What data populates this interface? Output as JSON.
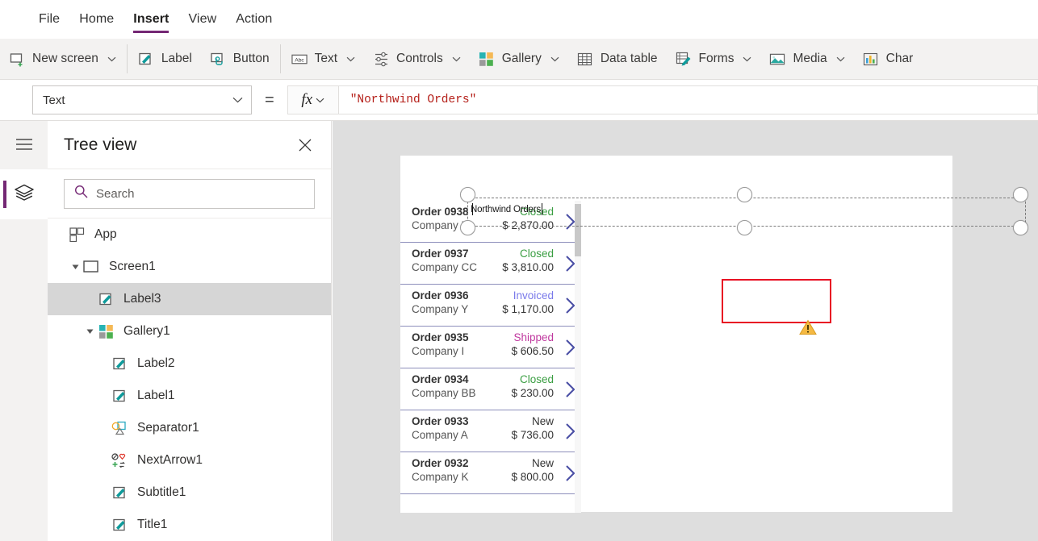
{
  "menu": {
    "items": [
      {
        "label": "File",
        "active": false
      },
      {
        "label": "Home",
        "active": false
      },
      {
        "label": "Insert",
        "active": true
      },
      {
        "label": "View",
        "active": false
      },
      {
        "label": "Action",
        "active": false
      }
    ],
    "accent_color": "#742774"
  },
  "ribbon": {
    "groups": [
      {
        "items": [
          {
            "label": "New screen",
            "icon": "new-screen-icon",
            "caret": true
          }
        ]
      },
      {
        "items": [
          {
            "label": "Label",
            "icon": "label-icon",
            "caret": false
          },
          {
            "label": "Button",
            "icon": "button-icon",
            "caret": false
          }
        ]
      },
      {
        "items": [
          {
            "label": "Text",
            "icon": "text-abc-icon",
            "caret": true
          },
          {
            "label": "Controls",
            "icon": "controls-sliders-icon",
            "caret": true
          },
          {
            "label": "Gallery",
            "icon": "gallery-grid-icon",
            "caret": true
          },
          {
            "label": "Data table",
            "icon": "data-table-icon",
            "caret": false
          },
          {
            "label": "Forms",
            "icon": "forms-icon",
            "caret": true
          },
          {
            "label": "Media",
            "icon": "media-image-icon",
            "caret": true
          },
          {
            "label": "Char",
            "icon": "chart-bars-icon",
            "caret": false
          }
        ]
      }
    ]
  },
  "formula_bar": {
    "property": "Text",
    "equals": "=",
    "fx_label": "fx",
    "formula": "\"Northwind Orders\"",
    "formula_color": "#b5201a"
  },
  "left_rail": {
    "hamburger": "hamburger-menu-icon",
    "buttons": [
      {
        "name": "tree-view-layers",
        "icon": "layers-icon",
        "active": true
      }
    ]
  },
  "tree_view": {
    "title": "Tree view",
    "close_label": "✕",
    "search_placeholder": "Search",
    "nodes": [
      {
        "label": "App",
        "icon": "app-icon",
        "indent": 0,
        "twisty": "",
        "selected": false
      },
      {
        "label": "Screen1",
        "icon": "screen-icon",
        "indent": 1,
        "twisty": "expanded",
        "selected": false
      },
      {
        "label": "Label3",
        "icon": "label-pencil-icon",
        "indent": 2,
        "twisty": "",
        "selected": true
      },
      {
        "label": "Gallery1",
        "icon": "gallery-grid-icon",
        "indent": 1,
        "twisty": "expanded",
        "selected": false
      },
      {
        "label": "Label2",
        "icon": "label-pencil-icon",
        "indent": 3,
        "twisty": "",
        "selected": false
      },
      {
        "label": "Label1",
        "icon": "label-pencil-icon",
        "indent": 3,
        "twisty": "",
        "selected": false
      },
      {
        "label": "Separator1",
        "icon": "separator-shapes-icon",
        "indent": 3,
        "twisty": "",
        "selected": false
      },
      {
        "label": "NextArrow1",
        "icon": "icon-set-icon",
        "indent": 3,
        "twisty": "",
        "selected": false
      },
      {
        "label": "Subtitle1",
        "icon": "label-pencil-icon",
        "indent": 3,
        "twisty": "",
        "selected": false
      },
      {
        "label": "Title1",
        "icon": "label-pencil-icon",
        "indent": 3,
        "twisty": "",
        "selected": false
      }
    ]
  },
  "canvas": {
    "selected_label": {
      "text": "Northwind Orders",
      "editing": true,
      "highlight_color": "#e81123",
      "warning_icon": "warning-triangle-icon"
    },
    "gallery": {
      "status_colors": {
        "Closed": "#3a9e42",
        "Invoiced": "#7a7aea",
        "Shipped": "#c0399f",
        "New": "#333333"
      },
      "rows": [
        {
          "order": "Order 0938",
          "company": "Company F",
          "status": "Closed",
          "amount": "$ 2,870.00"
        },
        {
          "order": "Order 0937",
          "company": "Company CC",
          "status": "Closed",
          "amount": "$ 3,810.00"
        },
        {
          "order": "Order 0936",
          "company": "Company Y",
          "status": "Invoiced",
          "amount": "$ 1,170.00"
        },
        {
          "order": "Order 0935",
          "company": "Company I",
          "status": "Shipped",
          "amount": "$ 606.50"
        },
        {
          "order": "Order 0934",
          "company": "Company BB",
          "status": "Closed",
          "amount": "$ 230.00"
        },
        {
          "order": "Order 0933",
          "company": "Company A",
          "status": "New",
          "amount": "$ 736.00"
        },
        {
          "order": "Order 0932",
          "company": "Company K",
          "status": "New",
          "amount": "$ 800.00"
        }
      ]
    }
  }
}
